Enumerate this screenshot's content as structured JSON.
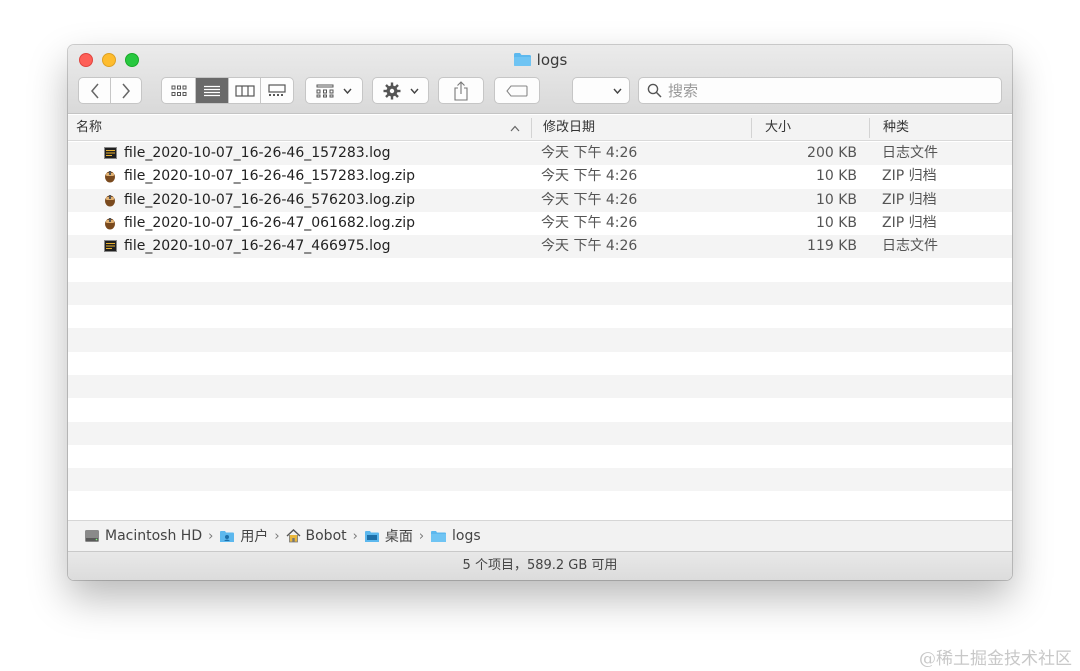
{
  "window": {
    "title": "logs"
  },
  "toolbar": {
    "back": "〈",
    "forward": "〉",
    "search_placeholder": "搜索"
  },
  "columns": {
    "name": "名称",
    "date": "修改日期",
    "size": "大小",
    "kind": "种类"
  },
  "files": [
    {
      "name": "file_2020-10-07_16-26-46_157283.log",
      "date": "今天 下午 4:26",
      "size": "200 KB",
      "kind": "日志文件",
      "icon": "log-file-icon"
    },
    {
      "name": "file_2020-10-07_16-26-46_157283.log.zip",
      "date": "今天 下午 4:26",
      "size": "10 KB",
      "kind": "ZIP 归档",
      "icon": "zip-file-icon"
    },
    {
      "name": "file_2020-10-07_16-26-46_576203.log.zip",
      "date": "今天 下午 4:26",
      "size": "10 KB",
      "kind": "ZIP 归档",
      "icon": "zip-file-icon"
    },
    {
      "name": "file_2020-10-07_16-26-47_061682.log.zip",
      "date": "今天 下午 4:26",
      "size": "10 KB",
      "kind": "ZIP 归档",
      "icon": "zip-file-icon"
    },
    {
      "name": "file_2020-10-07_16-26-47_466975.log",
      "date": "今天 下午 4:26",
      "size": "119 KB",
      "kind": "日志文件",
      "icon": "log-file-icon"
    }
  ],
  "pathbar": {
    "items": [
      "Macintosh HD",
      "用户",
      "Bobot",
      "桌面",
      "logs"
    ],
    "separator": "›"
  },
  "status": {
    "text": "5 个项目，589.2 GB 可用"
  },
  "watermark": "@稀土掘金技术社区",
  "colors": {
    "folder": "#5cb8ee",
    "close": "#fe5f57",
    "minimize": "#febc2e",
    "zoom": "#28c840"
  }
}
